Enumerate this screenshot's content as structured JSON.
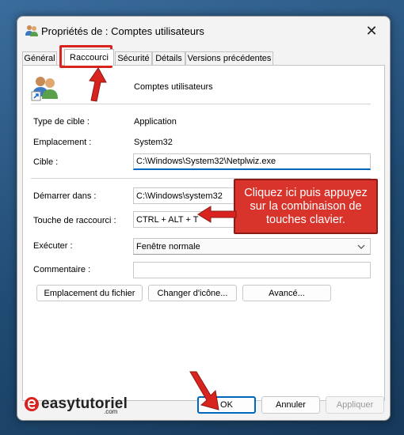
{
  "window": {
    "title": "Propriétés de : Comptes utilisateurs",
    "close_glyph": "✕"
  },
  "tabs": [
    {
      "label": "Général"
    },
    {
      "label": "Raccourci"
    },
    {
      "label": "Sécurité"
    },
    {
      "label": "Détails"
    },
    {
      "label": "Versions précédentes"
    }
  ],
  "shortcut": {
    "name": "Comptes utilisateurs",
    "target_type_label": "Type de cible :",
    "target_type_value": "Application",
    "location_label": "Emplacement :",
    "location_value": "System32",
    "target_label": "Cible :",
    "target_value": "C:\\Windows\\System32\\Netplwiz.exe",
    "start_in_label": "Démarrer dans :",
    "start_in_value": "C:\\Windows\\system32",
    "hotkey_label": "Touche de raccourci :",
    "hotkey_value": "CTRL + ALT + T",
    "run_label": "Exécuter :",
    "run_value": "Fenêtre normale",
    "comment_label": "Commentaire :",
    "comment_value": ""
  },
  "actions": {
    "open_location": "Emplacement du fichier",
    "change_icon": "Changer d'icône...",
    "advanced": "Avancé..."
  },
  "footer": {
    "ok": "OK",
    "cancel": "Annuler",
    "apply": "Appliquer"
  },
  "annotation": {
    "callout_text": "Cliquez ici puis appuyez sur la combinaison de touches clavier.",
    "color": "#d9342b"
  },
  "watermark": {
    "brand": "easytutoriel",
    "suffix": ".com"
  }
}
